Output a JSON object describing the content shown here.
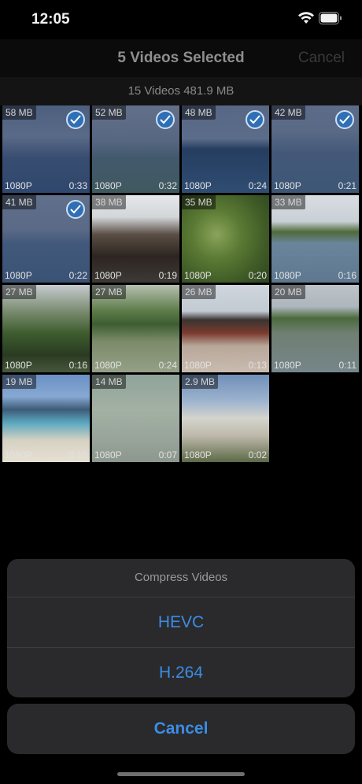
{
  "status": {
    "time": "12:05"
  },
  "nav": {
    "title": "5 Videos Selected",
    "cancel_label": "Cancel"
  },
  "info": {
    "summary": "15 Videos   481.9 MB"
  },
  "videos": [
    {
      "size": "58 MB",
      "res": "1080P",
      "dur": "0:33",
      "selected": true
    },
    {
      "size": "52 MB",
      "res": "1080P",
      "dur": "0:32",
      "selected": true
    },
    {
      "size": "48 MB",
      "res": "1080P",
      "dur": "0:24",
      "selected": true
    },
    {
      "size": "42 MB",
      "res": "1080P",
      "dur": "0:21",
      "selected": true
    },
    {
      "size": "41 MB",
      "res": "1080P",
      "dur": "0:22",
      "selected": true
    },
    {
      "size": "38 MB",
      "res": "1080P",
      "dur": "0:19",
      "selected": false
    },
    {
      "size": "35 MB",
      "res": "1080P",
      "dur": "0:20",
      "selected": false
    },
    {
      "size": "33 MB",
      "res": "1080P",
      "dur": "0:16",
      "selected": false
    },
    {
      "size": "27 MB",
      "res": "1080P",
      "dur": "0:16",
      "selected": false
    },
    {
      "size": "27 MB",
      "res": "1080P",
      "dur": "0:24",
      "selected": false
    },
    {
      "size": "26 MB",
      "res": "1080P",
      "dur": "0:13",
      "selected": false
    },
    {
      "size": "20 MB",
      "res": "1080P",
      "dur": "0:11",
      "selected": false
    },
    {
      "size": "19 MB",
      "res": "1080P",
      "dur": "0:10",
      "selected": false
    },
    {
      "size": "14 MB",
      "res": "1080P",
      "dur": "0:07",
      "selected": false
    },
    {
      "size": "2.9 MB",
      "res": "1080P",
      "dur": "0:02",
      "selected": false
    }
  ],
  "sheet": {
    "title": "Compress Videos",
    "option1": "HEVC",
    "option2": "H.264",
    "cancel": "Cancel"
  },
  "colors": {
    "accent": "#3b8de6",
    "check": "#2f6fb5"
  }
}
